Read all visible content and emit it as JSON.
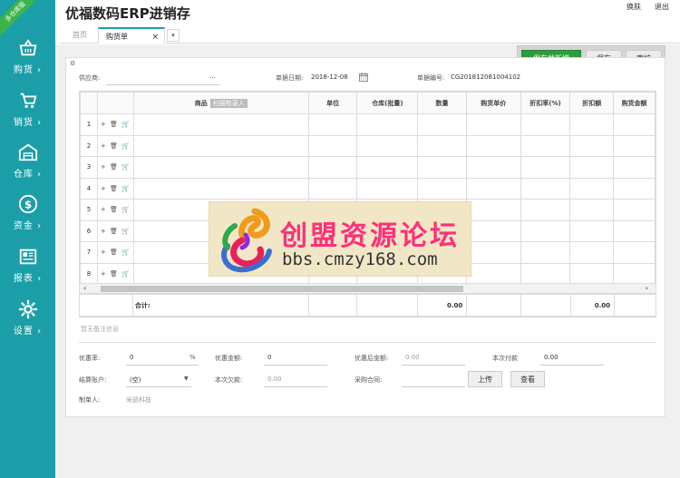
{
  "app": {
    "title": "优福数码ERP进销存",
    "ribbon": "多仓库版"
  },
  "top_links": {
    "switch": "换肤",
    "logout": "退出"
  },
  "tabs": {
    "home": "首页",
    "active": "购货单",
    "close": "×",
    "more": "▾"
  },
  "sidebar": {
    "items": [
      {
        "label": "购货 ›",
        "icon": "basket-icon"
      },
      {
        "label": "销货 ›",
        "icon": "cart-icon"
      },
      {
        "label": "仓库 ›",
        "icon": "warehouse-icon"
      },
      {
        "label": "资金 ›",
        "icon": "dollar-icon"
      },
      {
        "label": "报表 ›",
        "icon": "report-icon"
      },
      {
        "label": "设置 ›",
        "icon": "gear-icon"
      }
    ],
    "color": "#1c9ea8"
  },
  "actions": {
    "save_new": "保存并新增",
    "save": "保存",
    "audit": "审核"
  },
  "form": {
    "supplier_label": "供应商:",
    "supplier_value": "...",
    "date_label": "单据日期:",
    "date_value": "2018-12-08",
    "number_label": "单据编号:",
    "number_value": "CG201812081004102"
  },
  "grid": {
    "headers": {
      "goods": "商品",
      "scan": "扫描枪录入",
      "unit": "单位",
      "warehouse": "仓库(批量)",
      "qty": "数量",
      "price": "购货单价",
      "discount_rate": "折扣率(%)",
      "discount_amount": "折扣额",
      "amount": "购货金额"
    },
    "rows": [
      "1",
      "2",
      "3",
      "4",
      "5",
      "6",
      "7",
      "8"
    ],
    "row_ops": "+ 🗑 🛒",
    "total_label": "合计:",
    "total_qty": "0.00",
    "total_discount": "0.00"
  },
  "remark_placeholder": "暂无备注信息",
  "footer": {
    "discount_rate_label": "优惠率:",
    "discount_rate_value": "0",
    "percent": "%",
    "discount_amount_label": "优惠金额:",
    "discount_amount_value": "0",
    "after_discount_label": "优惠后金额:",
    "after_discount_value": "0.00",
    "paid_label": "本次付款",
    "paid_value": "0.00",
    "account_label": "结算账户:",
    "account_value": "(空)",
    "owe_label": "本次欠款:",
    "owe_value": "0.00",
    "contract_label": "采购合同:",
    "upload": "上传",
    "view": "查看",
    "maker_label": "制单人:",
    "maker_value": "米凯科技"
  },
  "watermark": {
    "cn": "创盟资源论坛",
    "en": "bbs.cmzy168.com"
  }
}
